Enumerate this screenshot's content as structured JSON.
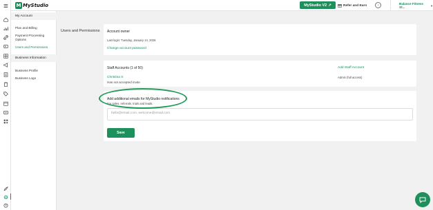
{
  "header": {
    "brand": "MyStudio",
    "v2_button": "MyStudio V2",
    "refer_label": "Refer and Earn",
    "business_name": "Balance Fitness St..."
  },
  "menu": {
    "section_account": "My Account",
    "plan_billing": "Plan and Billing",
    "payment_processing": "Payment Processing Options",
    "users_permissions": "Users and Permissions",
    "section_business": "Business Information",
    "business_profile": "Business Profile",
    "business_logo": "Business Logo"
  },
  "page": {
    "title": "Users and Permissions"
  },
  "owner_card": {
    "title": "Account owner",
    "last_login": "Last login: Tuesday, January 14, 2026",
    "change_password": "Change account password"
  },
  "staff_card": {
    "title": "Staff Accounts (1 of 50)",
    "add_staff": "Add Staff Account",
    "staff_name": "Christina S",
    "staff_status": "Has not accepted invite",
    "staff_role": "Admin (full access)"
  },
  "notify_card": {
    "title": "Add additional emails for MyStudio notifications",
    "subtitle": "For sales, referrals, trials and leads.",
    "email_placeholder": "hello@email.com, welcome@email.com",
    "save_label": "Save"
  },
  "colors": {
    "accent": "#1f8f5c",
    "link": "#1a8a5a",
    "highlight_oval": "#1f9a58"
  }
}
